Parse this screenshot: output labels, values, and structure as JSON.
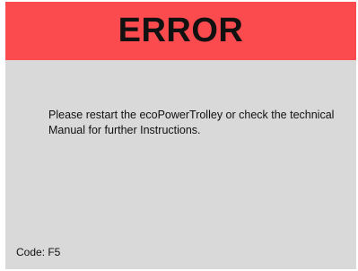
{
  "dialog": {
    "title": "ERROR",
    "message": "Please restart the ecoPowerTrolley or check the technical Manual for further Instructions.",
    "code_label": "Code: F5"
  },
  "colors": {
    "header_background": "#fb4b4e",
    "body_background": "#d9d9d9",
    "text": "#111111"
  }
}
